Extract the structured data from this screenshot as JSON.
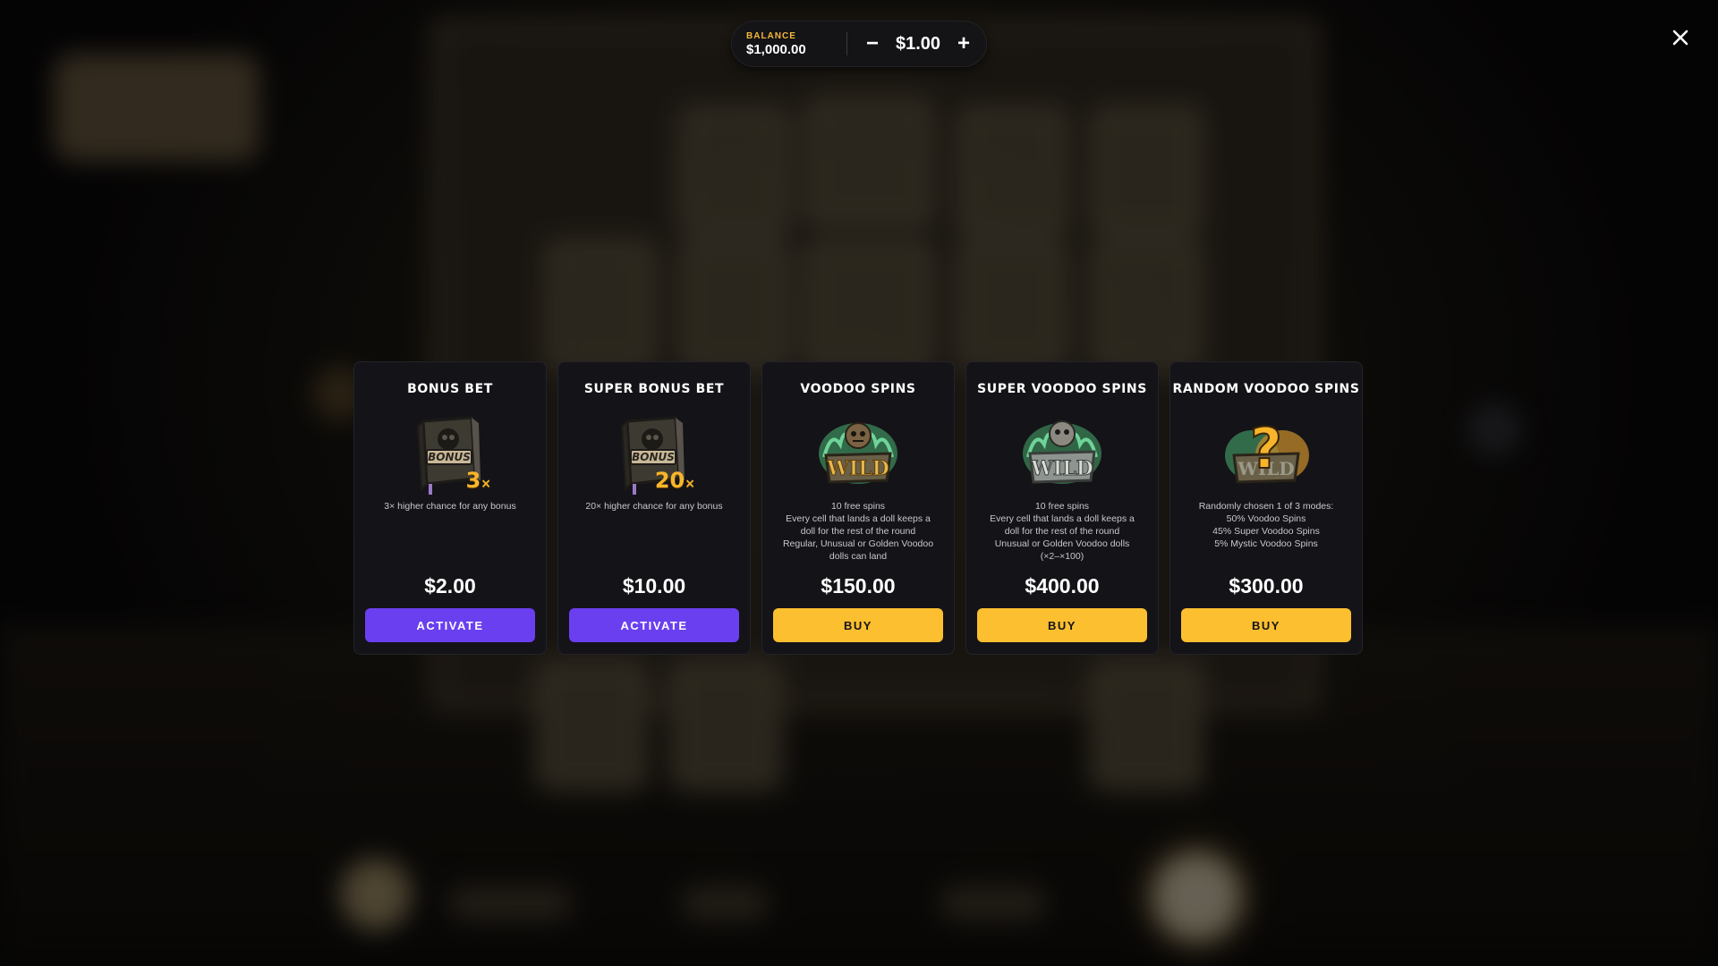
{
  "header": {
    "balance_label": "BALANCE",
    "balance_value": "$1,000.00",
    "minus_label": "−",
    "bet_value": "$1.00",
    "plus_label": "+"
  },
  "colors": {
    "accent_purple": "#6a3ff0",
    "accent_yellow": "#fbbf2f",
    "balance_label": "#f5b83a",
    "card_bg": "#141318"
  },
  "cards": [
    {
      "title": "BONUS BET",
      "art": "bonus-book-icon",
      "multiplier": "3",
      "multiplier_suffix": "×",
      "description": [
        "3× higher chance for any bonus"
      ],
      "price": "$2.00",
      "button_label": "ACTIVATE",
      "button_style": "purple"
    },
    {
      "title": "SUPER BONUS BET",
      "art": "bonus-book-icon",
      "multiplier": "20",
      "multiplier_suffix": "×",
      "description": [
        "20× higher chance for any bonus"
      ],
      "price": "$10.00",
      "button_label": "ACTIVATE",
      "button_style": "purple"
    },
    {
      "title": "VOODOO SPINS",
      "art": "voodoo-wild-icon",
      "description": [
        "10 free spins",
        "Every cell that lands a doll keeps a",
        "doll for the rest of the round",
        "Regular, Unusual or Golden Voodoo",
        "dolls can land"
      ],
      "price": "$150.00",
      "button_label": "BUY",
      "button_style": "yellow"
    },
    {
      "title": "SUPER VOODOO SPINS",
      "art": "super-voodoo-wild-icon",
      "description": [
        "10 free spins",
        "Every cell that lands a doll keeps a",
        "doll for the rest of the round",
        "Unusual or Golden Voodoo dolls",
        "(×2–×100)"
      ],
      "price": "$400.00",
      "button_label": "BUY",
      "button_style": "yellow"
    },
    {
      "title": "RANDOM VOODOO SPINS",
      "art": "random-voodoo-wild-icon",
      "description": [
        "Randomly chosen 1 of 3 modes:",
        "50% Voodoo Spins",
        "45% Super Voodoo Spins",
        "5% Mystic Voodoo Spins"
      ],
      "price": "$300.00",
      "button_label": "BUY",
      "button_style": "yellow"
    }
  ]
}
